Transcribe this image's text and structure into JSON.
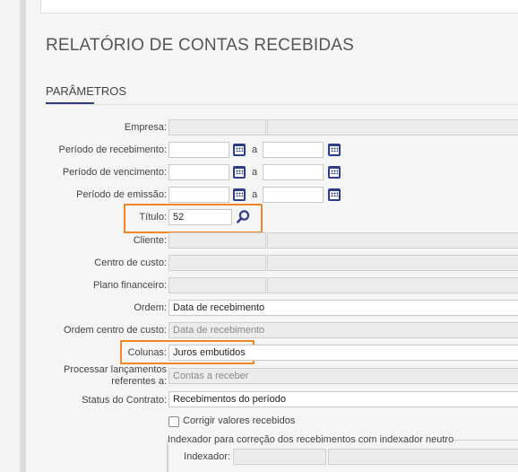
{
  "header": {
    "title": "RELATÓRIO DE CONTAS RECEBIDAS"
  },
  "section": {
    "title": "PARÂMETROS"
  },
  "form": {
    "empresa_label": "Empresa:",
    "periodo_recebimento_label": "Período de recebimento:",
    "periodo_vencimento_label": "Período de vencimento:",
    "periodo_emissao_label": "Período de emissão:",
    "date_separator": "a",
    "titulo_label": "Título:",
    "titulo_value": "52",
    "cliente_label": "Cliente:",
    "centro_custo_label": "Centro de custo:",
    "plano_financeiro_label": "Plano financeiro:",
    "ordem_label": "Ordem:",
    "ordem_value": "Data de recebimento",
    "ordem_centro_custo_label": "Ordem centro de custo:",
    "ordem_centro_custo_value": "Data de recebimento",
    "colunas_label": "Colunas:",
    "colunas_value": "Juros embutidos",
    "processar_label_line1": "Processar lançamentos",
    "processar_label_line2": "referentes a:",
    "processar_value": "Contas a receber",
    "status_contrato_label": "Status do Contrato:",
    "status_contrato_value": "Recebimentos do período",
    "corrigir_label": "Corrigir valores recebidos",
    "indexador_group_label": "Indexador para correção dos recebimentos com indexador neutro",
    "indexador_label": "Indexador:"
  },
  "colors": {
    "highlight": "#f0862a",
    "accent": "#2e3d8a"
  }
}
